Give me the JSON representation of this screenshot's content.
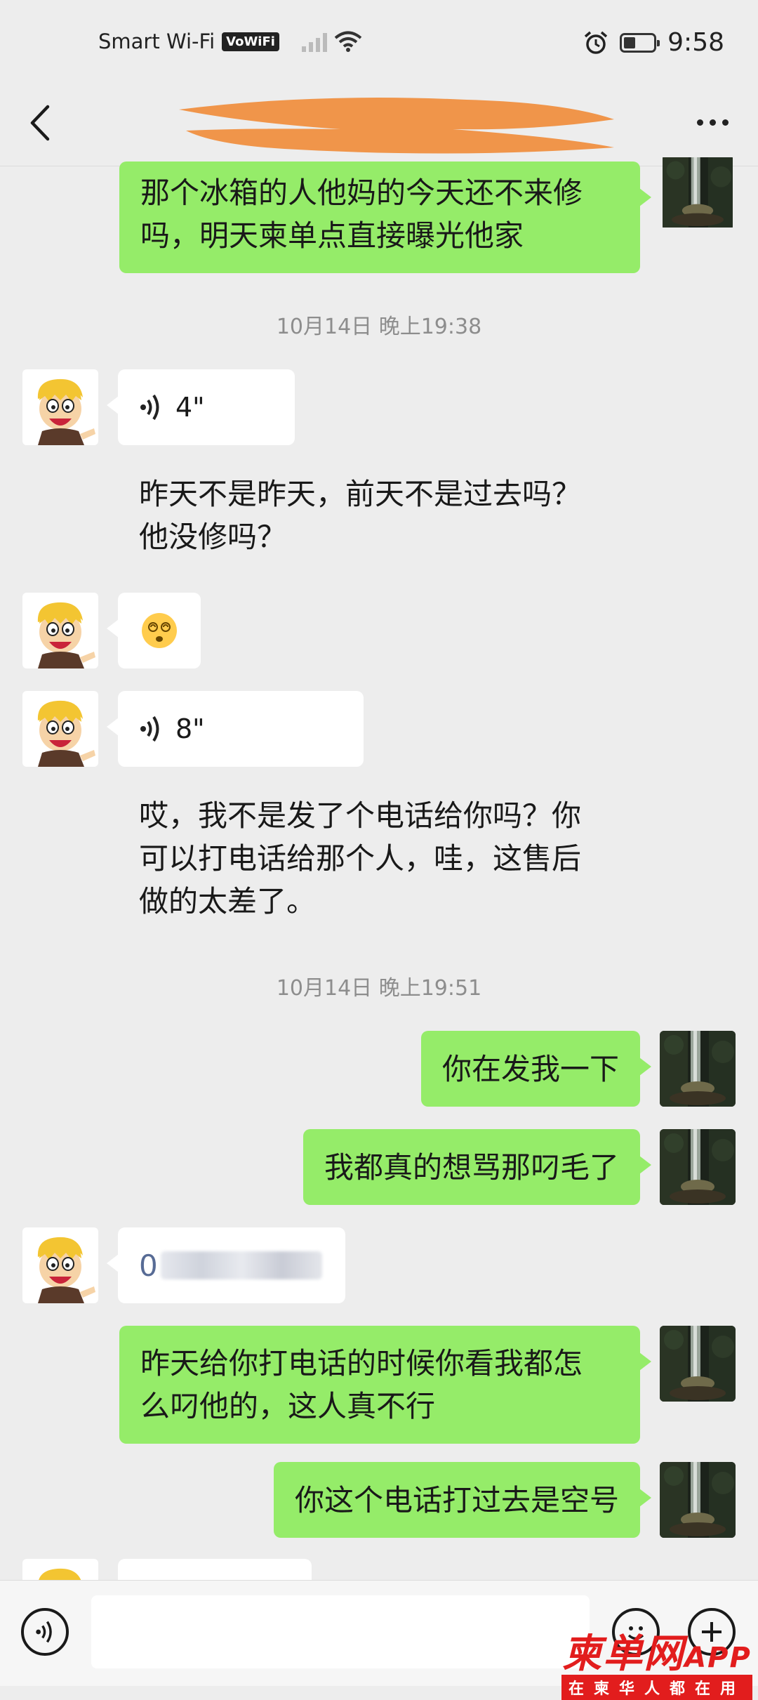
{
  "status_bar": {
    "network": "Smart Wi-Fi",
    "vowifi": "VoWiFi",
    "time": "9:58"
  },
  "header": {
    "more_label": "…"
  },
  "messages": [
    {
      "side": "right",
      "text_line1": "那个冰箱的人他妈的今天还不来修",
      "text_line2": "吗，明天柬单点直接曝光他家"
    },
    {
      "type": "timestamp",
      "text": "10月14日 晚上19:38"
    },
    {
      "side": "left",
      "voice": "4\""
    },
    {
      "side": "left",
      "text_line1": "昨天不是昨天，前天不是过去吗？",
      "text_line2": "他没修吗？"
    },
    {
      "side": "left",
      "emoji": "😵‍💫"
    },
    {
      "side": "left",
      "voice": "8\""
    },
    {
      "side": "left",
      "text_line1": "哎，我不是发了个电话给你吗？你",
      "text_line2": "可以打电话给那个人，哇，这售后",
      "text_line3": "做的太差了。"
    },
    {
      "type": "timestamp",
      "text": "10月14日 晚上19:51"
    },
    {
      "side": "right",
      "text": "你在发我一下"
    },
    {
      "side": "right",
      "text": "我都真的想骂那叼毛了"
    },
    {
      "side": "left",
      "text": "0"
    },
    {
      "side": "right",
      "text_line1": "昨天给你打电话的时候你看我都怎",
      "text_line2": "么叼他的，这人真不行"
    },
    {
      "side": "right",
      "text": "你这个电话打过去是空号"
    }
  ],
  "watermark": {
    "title": "柬单网",
    "app": "APP",
    "subtitle": "在柬华人都在用"
  }
}
